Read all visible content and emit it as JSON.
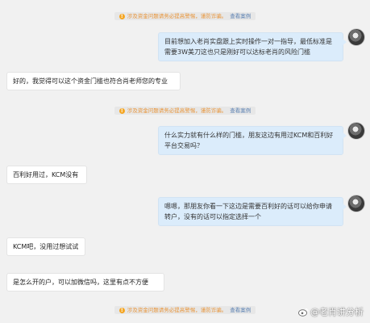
{
  "notice": {
    "icon": "warning-icon",
    "part1": "涉及资金问题请务必提高警惕，",
    "part2": "谨防诈骗。",
    "link": "查看案例"
  },
  "messages": [
    {
      "side": "right",
      "text": "目前想加入老肖实盘跟上实时操作一对一指导，最低标准是需要3W美刀这也只是刚好可以达标老肖的风险门槛"
    },
    {
      "side": "left",
      "text": "好的，我觉得可以这个资金门槛也符合肖老师您的专业"
    },
    {
      "side": "right",
      "text": "什么实力就有什么样的门槛，朋友这边有用过KCM和百利好平台交易吗？"
    },
    {
      "side": "left",
      "text": "百利好用过，KCM没有"
    },
    {
      "side": "right",
      "text": "嗯嗯，那朋友你看一下这边是需要百利好的话可以给你申请转户，没有的话可以指定选择一个"
    },
    {
      "side": "left",
      "text": "KCM吧，没用过想试试"
    },
    {
      "side": "left",
      "text": "是怎么开的户，可以加微信吗，这里有点不方便"
    }
  ],
  "watermark": {
    "icon": "weibo-icon",
    "text": "@老肖讲分析"
  },
  "colors": {
    "bubble_right": "#dbecfb",
    "bubble_left": "#ffffff",
    "background": "#f1f1f1",
    "warning": "#f5a623"
  }
}
